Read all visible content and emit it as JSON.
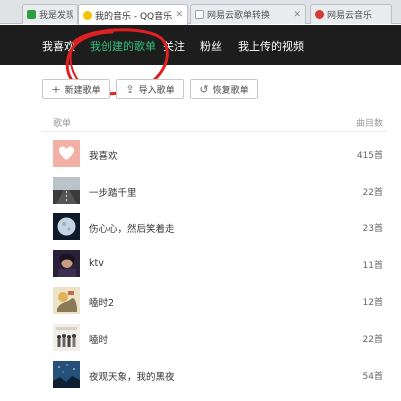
{
  "browser": {
    "tabs": [
      {
        "label": "我是发现",
        "icon": "leaf-icon",
        "color": "#2e9e3e",
        "active": false
      },
      {
        "label": "我的音乐 - QQ音乐-中国最新!",
        "icon": "qq-music-icon",
        "color": "#f2c400",
        "active": true
      },
      {
        "label": "网易云歌单转换",
        "icon": "page-icon",
        "color": "#9aa0a6",
        "active": false
      },
      {
        "label": "网易云音乐",
        "icon": "netease-music-icon",
        "color": "#d43c33",
        "active": false
      }
    ]
  },
  "nav": {
    "items": [
      {
        "label": "我喜欢",
        "active": false
      },
      {
        "label": "我创建的歌单",
        "active": true
      },
      {
        "label": "关注",
        "active": false
      },
      {
        "label": "粉丝",
        "active": false
      },
      {
        "label": "我上传的视频",
        "active": false
      }
    ],
    "accent_color": "#31c27c",
    "annotation_color": "#e02020"
  },
  "actions": {
    "new_playlist": "新建歌单",
    "import_playlist": "导入歌单",
    "restore_playlist": "恢复歌单"
  },
  "list": {
    "header_name": "歌单",
    "header_count": "曲目数",
    "rows": [
      {
        "name": "我喜欢",
        "count": "415首",
        "cover": "heart-cover"
      },
      {
        "name": "一步踏千里",
        "count": "22首",
        "cover": "road-cover"
      },
      {
        "name": "伤心心，然后笑着走",
        "count": "23首",
        "cover": "moon-cover"
      },
      {
        "name": "ktv",
        "count": "11首",
        "cover": "portrait-cover"
      },
      {
        "name": "嗑时2",
        "count": "12首",
        "cover": "art-cover"
      },
      {
        "name": "嗑时",
        "count": "22首",
        "cover": "band-cover"
      },
      {
        "name": "夜观天象，我的黑夜",
        "count": "54首",
        "cover": "night-sky-cover"
      }
    ]
  }
}
